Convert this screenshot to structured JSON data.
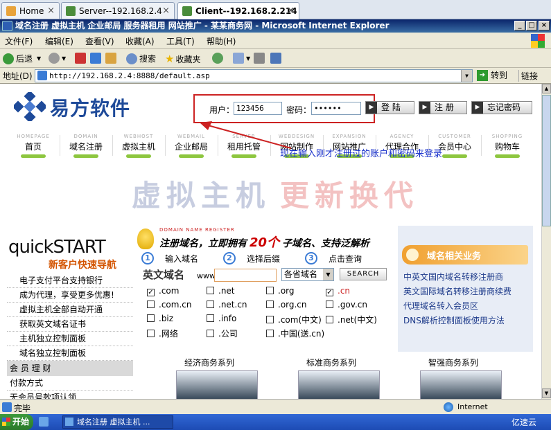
{
  "host_tabs": [
    {
      "label": "Home",
      "icon": "home-icon"
    },
    {
      "label": "Server--192.168.2.4",
      "icon": "vm-icon"
    },
    {
      "label": "Client--192.168.2.214",
      "icon": "vm-icon"
    }
  ],
  "window": {
    "title": "域名注册 虚拟主机 企业邮局 服务器租用 网站推广 - 某某商务网 - Microsoft Internet Explorer",
    "min": "_",
    "max": "□",
    "close": "×"
  },
  "menu": [
    "文件(F)",
    "编辑(E)",
    "查看(V)",
    "收藏(A)",
    "工具(T)",
    "帮助(H)"
  ],
  "toolbar": {
    "back": "后退",
    "search": "搜索",
    "favorites": "收藏夹"
  },
  "address": {
    "label": "地址(D)",
    "url": "http://192.168.2.4:8888/default.asp",
    "go": "转到",
    "links": "链接"
  },
  "site": {
    "logo": "易方软件",
    "login": {
      "user_label": "用户：",
      "user_value": "123456",
      "pass_label": "密码：",
      "pass_value": "••••••",
      "login_btn": "登 陆",
      "register_btn": "注 册",
      "forgot_btn": "忘记密码"
    },
    "annotation": "现在输入刚才注册过的账户和密码来登录",
    "nav": [
      {
        "en": "HOMEPAGE",
        "cn": "首页"
      },
      {
        "en": "DOMAIN",
        "cn": "域名注册"
      },
      {
        "en": "WEBHOST",
        "cn": "虚拟主机"
      },
      {
        "en": "WEBMAIL",
        "cn": "企业邮局"
      },
      {
        "en": "SERVER",
        "cn": "租用托管"
      },
      {
        "en": "WEBDESIGN",
        "cn": "网站制作"
      },
      {
        "en": "EXPANSION",
        "cn": "网站推广"
      },
      {
        "en": "AGENCY",
        "cn": "代理合作"
      },
      {
        "en": "CUSTOMER",
        "cn": "会员中心"
      },
      {
        "en": "SHOPPING",
        "cn": "购物车"
      }
    ],
    "banner": {
      "part1": "虚拟主机",
      "part2": "更新换代"
    },
    "quickstart": {
      "title": "quickSTART",
      "subtitle": "新客户快速导航"
    },
    "side_items": [
      "电子支付平台支持银行",
      "成为代理，享受更多优惠!",
      "虚拟主机全部自动开通",
      "获取英文域名证书",
      "主机独立控制面板",
      "域名独立控制面板"
    ],
    "side_section": "会 员 理 财",
    "side_items2": [
      "付款方式",
      "无会员号款项认领"
    ],
    "domain": {
      "tag": "DOMAIN NAME REGISTER",
      "headline_a": "注册域名，立即拥有",
      "headline_num": "20个",
      "headline_b": "子域名、支持泛解析",
      "steps": [
        {
          "n": "1",
          "t": "输入域名"
        },
        {
          "n": "2",
          "t": "选择后缀"
        },
        {
          "n": "3",
          "t": "点击查询"
        }
      ],
      "label": "英文域名",
      "prefix": "www.",
      "select": "各省域名",
      "search_btn": "SEARCH",
      "exts": [
        [
          {
            "t": ".com",
            "c": true
          },
          {
            "t": ".net",
            "c": false
          },
          {
            "t": ".org",
            "c": false
          },
          {
            "t": ".cn",
            "c": true
          }
        ],
        [
          {
            "t": ".com.cn",
            "c": false
          },
          {
            "t": ".net.cn",
            "c": false
          },
          {
            "t": ".org.cn",
            "c": false
          },
          {
            "t": ".gov.cn",
            "c": false
          }
        ],
        [
          {
            "t": ".biz",
            "c": false
          },
          {
            "t": ".info",
            "c": false
          },
          {
            "t": ".com(中文)",
            "c": false
          },
          {
            "t": ".net(中文)",
            "c": false
          }
        ],
        [
          {
            "t": ".网络",
            "c": false
          },
          {
            "t": ".公司",
            "c": false
          },
          {
            "t": ".中国(送.cn)",
            "c": false
          }
        ]
      ]
    },
    "related": {
      "title": "域名相关业务",
      "links": [
        "中英文国内域名转移注册商",
        "英文国际域名转移注册商续费",
        "代理域名转入会员区",
        "DNS解析控制面板使用方法"
      ]
    },
    "series": [
      "经济商务系列",
      "标准商务系列",
      "智强商务系列"
    ]
  },
  "status": {
    "text": "完毕",
    "zone": "Internet"
  },
  "taskbar": {
    "start": "开始",
    "task": "域名注册 虚拟主机 ...",
    "watermark": "亿速云"
  },
  "colors": {
    "accent": "#1e4a99",
    "annotation": "#1b33cc",
    "highlight": "#cc2222",
    "banner_blue": "#c7cde0",
    "banner_red": "#f3c2c2"
  }
}
